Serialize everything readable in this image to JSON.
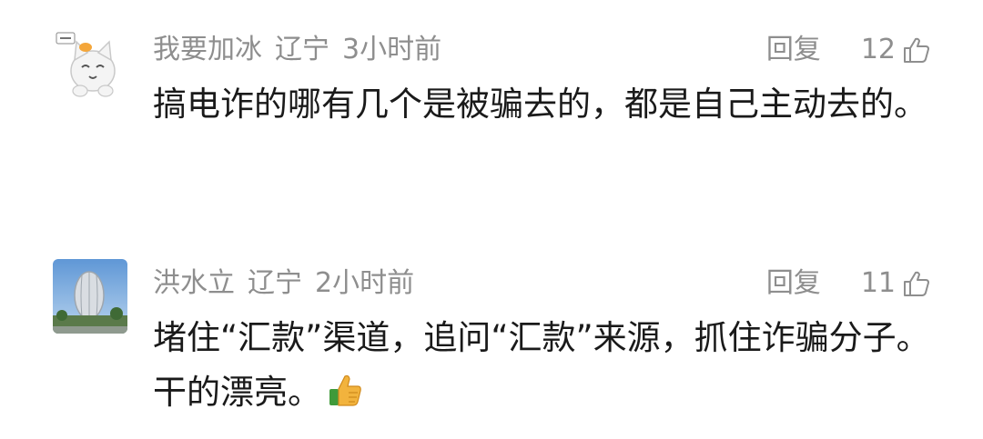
{
  "comments": [
    {
      "avatar": "cat-avatar",
      "username": "我要加冰",
      "location": "辽宁",
      "time": "3小时前",
      "reply_label": "回复",
      "likes": "12",
      "text": "搞电诈的哪有几个是被骗去的，都是自己主动去的。"
    },
    {
      "avatar": "building-avatar",
      "username": "洪水立",
      "location": "辽宁",
      "time": "2小时前",
      "reply_label": "回复",
      "likes": "11",
      "text": "堵住“汇款”渠道，追问“汇款”来源，抓住诈骗分子。干的漂亮。",
      "emoji": "thumbs-up-emoji"
    }
  ],
  "colors": {
    "meta": "#8e8e8e",
    "text": "#1a1a1a",
    "thumb_emoji": "#f2b33d"
  }
}
